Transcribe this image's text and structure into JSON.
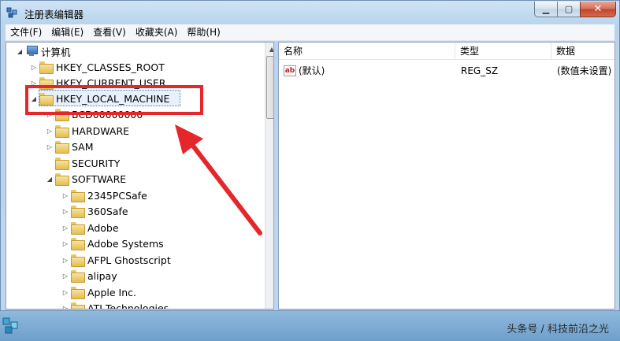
{
  "window": {
    "title": "注册表编辑器",
    "controls": {
      "minimize": "▁",
      "maximize": "▢",
      "close": "✕"
    }
  },
  "menu": [
    "文件(F)",
    "编辑(E)",
    "查看(V)",
    "收藏夹(A)",
    "帮助(H)"
  ],
  "tree": {
    "root": "计算机",
    "items": [
      "HKEY_CLASSES_ROOT",
      "HKEY_CURRENT_USER",
      "HKEY_LOCAL_MACHINE",
      "BCD00000000",
      "HARDWARE",
      "SAM",
      "SECURITY",
      "SOFTWARE",
      "2345PCSafe",
      "360Safe",
      "Adobe",
      "Adobe Systems",
      "AFPL Ghostscript",
      "alipay",
      "Apple Inc.",
      "ATI Technologies"
    ],
    "selected": "HKEY_LOCAL_MACHINE"
  },
  "list": {
    "columns": [
      "名称",
      "类型",
      "数据"
    ],
    "rows": [
      {
        "name": "(默认)",
        "type": "REG_SZ",
        "data": "(数值未设置)"
      }
    ]
  },
  "watermark": "头条号 / 科技前沿之光",
  "colors": {
    "annotation": "#e5262b",
    "selection": "#3c7fb1"
  }
}
